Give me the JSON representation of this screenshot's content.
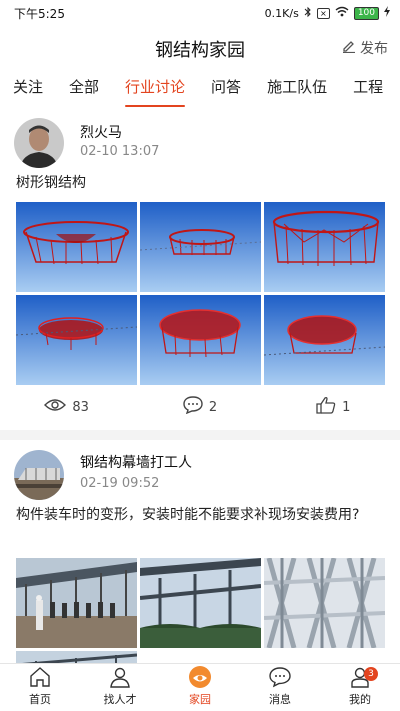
{
  "status_bar": {
    "time": "下午5:25",
    "speed": "0.1K/s",
    "battery": "100"
  },
  "header": {
    "title": "钢结构家园",
    "publish_label": "发布"
  },
  "tabs": [
    {
      "label": "关注"
    },
    {
      "label": "全部"
    },
    {
      "label": "行业讨论"
    },
    {
      "label": "问答"
    },
    {
      "label": "施工队伍"
    },
    {
      "label": "工程"
    }
  ],
  "active_tab": "行业讨论",
  "posts": [
    {
      "user": "烈火马",
      "time": "02-10 13:07",
      "text": "树形钢结构",
      "views": "83",
      "comments": "2",
      "likes": "1"
    },
    {
      "user": "钢结构幕墙打工人",
      "time": "02-19 09:52",
      "text": "构件装车时的变形，安装时能不能要求补现场安装费用?"
    }
  ],
  "bottom_nav": [
    {
      "label": "首页",
      "icon": "home-icon"
    },
    {
      "label": "找人才",
      "icon": "person-icon"
    },
    {
      "label": "家园",
      "icon": "community-icon"
    },
    {
      "label": "消息",
      "icon": "message-icon"
    },
    {
      "label": "我的",
      "icon": "profile-icon",
      "badge": "3"
    }
  ],
  "colors": {
    "accent": "#e3441f",
    "render_blue": "#2d6fd0",
    "steel_red": "#c01616"
  }
}
